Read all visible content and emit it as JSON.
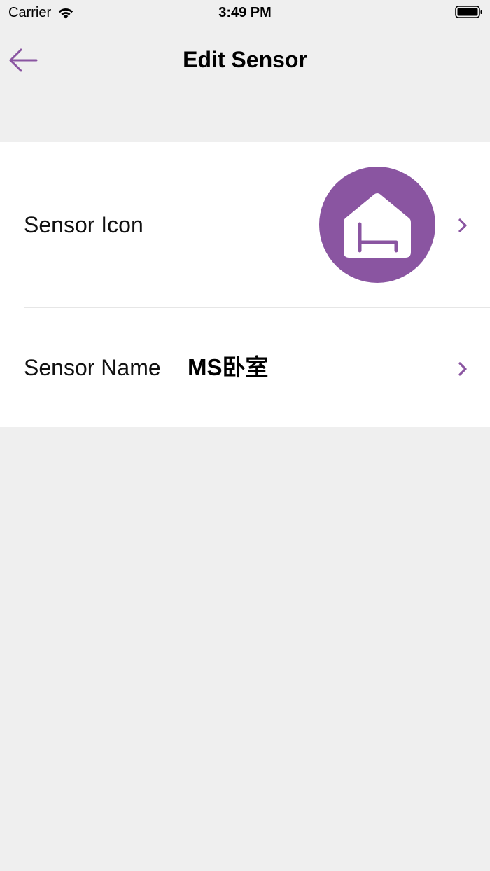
{
  "status_bar": {
    "carrier": "Carrier",
    "time": "3:49 PM",
    "wifi_icon": "wifi-icon",
    "battery_icon": "battery-icon"
  },
  "nav": {
    "title": "Edit Sensor",
    "back_icon": "arrow-left-icon"
  },
  "rows": {
    "icon": {
      "label": "Sensor Icon",
      "icon": "house-bed-icon"
    },
    "name": {
      "label": "Sensor Name",
      "value": "MS卧室"
    }
  },
  "colors": {
    "accent": "#8a55a1",
    "background": "#efefef",
    "card": "#ffffff",
    "divider": "#e6e6e6"
  }
}
